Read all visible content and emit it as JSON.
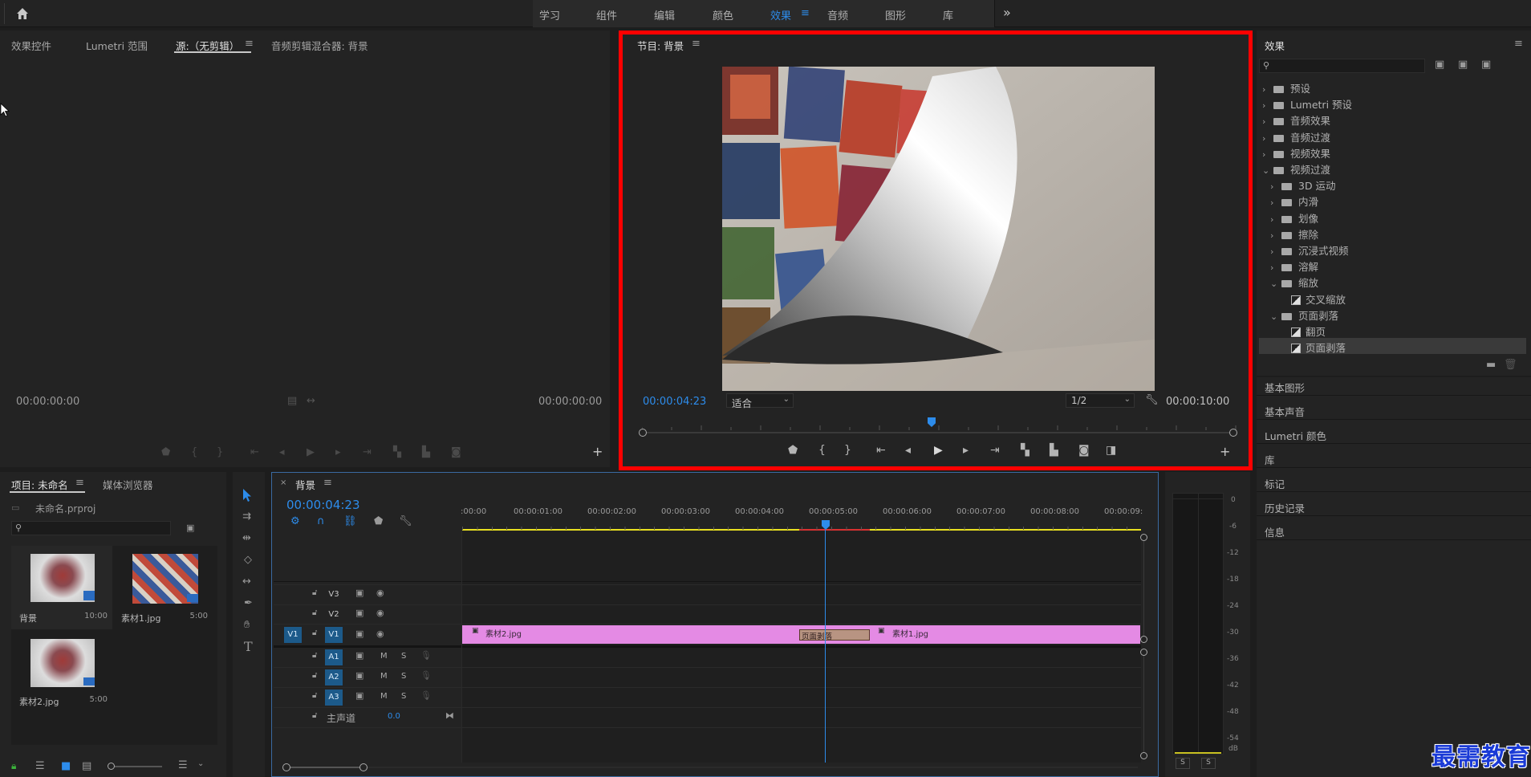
{
  "workspace": {
    "items": [
      "学习",
      "组件",
      "编辑",
      "颜色",
      "效果",
      "音频",
      "图形",
      "库"
    ],
    "active_index": 4,
    "more_label": "»"
  },
  "source_panel": {
    "tabs": [
      "效果控件",
      "Lumetri 范围",
      "源:（无剪辑）",
      "音频剪辑混合器: 背景"
    ],
    "active_tab": "源:（无剪辑）",
    "timecode_left": "00:00:00:00",
    "timecode_right": "00:00:00:00"
  },
  "program_monitor": {
    "title": "节目: 背景",
    "timecode_current": "00:00:04:23",
    "fit": "适合",
    "resolution": "1/2",
    "timecode_duration": "00:00:10:00",
    "playhead_fraction": 0.49
  },
  "project_panel": {
    "tabs": [
      "项目: 未命名",
      "媒体浏览器"
    ],
    "project_file": "未命名.prproj",
    "items": [
      {
        "name": "背景",
        "duration": "10:00"
      },
      {
        "name": "素材1.jpg",
        "duration": "5:00"
      },
      {
        "name": "素材2.jpg",
        "duration": "5:00"
      }
    ]
  },
  "timeline": {
    "sequence_name": "背景",
    "timecode": "00:00:04:23",
    "ruler": [
      ":00:00",
      "00:00:01:00",
      "00:00:02:00",
      "00:00:03:00",
      "00:00:04:00",
      "00:00:05:00",
      "00:00:06:00",
      "00:00:07:00",
      "00:00:08:00",
      "00:00:09:"
    ],
    "video_tracks": [
      "V3",
      "V2",
      "V1"
    ],
    "source_patch": "V1",
    "audio_tracks": [
      "A1",
      "A2",
      "A3"
    ],
    "mute_label": "M",
    "solo_label": "S",
    "master_label": "主声道",
    "master_value": "0.0",
    "clips": [
      {
        "name": "素材2.jpg"
      },
      {
        "name": "页面剥落"
      },
      {
        "name": "素材1.jpg"
      }
    ]
  },
  "audio_meter": {
    "scale": [
      "0",
      "-6",
      "-12",
      "-18",
      "-24",
      "-30",
      "-36",
      "-42",
      "-48",
      "-54",
      "dB"
    ],
    "solo_labels": [
      "S",
      "S"
    ]
  },
  "effects_panel": {
    "title": "效果",
    "search_placeholder": "",
    "tree": [
      {
        "label": "预设",
        "level": 0,
        "kind": "folder",
        "expanded": false
      },
      {
        "label": "Lumetri 预设",
        "level": 0,
        "kind": "folder",
        "expanded": false
      },
      {
        "label": "音频效果",
        "level": 0,
        "kind": "folder",
        "expanded": false
      },
      {
        "label": "音频过渡",
        "level": 0,
        "kind": "folder",
        "expanded": false
      },
      {
        "label": "视频效果",
        "level": 0,
        "kind": "folder",
        "expanded": false
      },
      {
        "label": "视频过渡",
        "level": 0,
        "kind": "folder",
        "expanded": true
      },
      {
        "label": "3D 运动",
        "level": 1,
        "kind": "folder",
        "expanded": false
      },
      {
        "label": "内滑",
        "level": 1,
        "kind": "folder",
        "expanded": false
      },
      {
        "label": "划像",
        "level": 1,
        "kind": "folder",
        "expanded": false
      },
      {
        "label": "擦除",
        "level": 1,
        "kind": "folder",
        "expanded": false
      },
      {
        "label": "沉浸式视频",
        "level": 1,
        "kind": "folder",
        "expanded": false
      },
      {
        "label": "溶解",
        "level": 1,
        "kind": "folder",
        "expanded": false
      },
      {
        "label": "缩放",
        "level": 1,
        "kind": "folder",
        "expanded": true
      },
      {
        "label": "交叉缩放",
        "level": 2,
        "kind": "effect"
      },
      {
        "label": "页面剥落",
        "level": 1,
        "kind": "folder",
        "expanded": true
      },
      {
        "label": "翻页",
        "level": 2,
        "kind": "effect"
      },
      {
        "label": "页面剥落",
        "level": 2,
        "kind": "effect",
        "selected": true
      }
    ],
    "sections": [
      "基本图形",
      "基本声音",
      "Lumetri 颜色",
      "库",
      "标记",
      "历史记录",
      "信息"
    ]
  },
  "watermark": "最需教育",
  "colors": {
    "accent": "#2d8ceb",
    "highlight_red": "#ff0000",
    "clip_pink": "#e48ae4",
    "work_area_yellow": "#e8e020"
  }
}
